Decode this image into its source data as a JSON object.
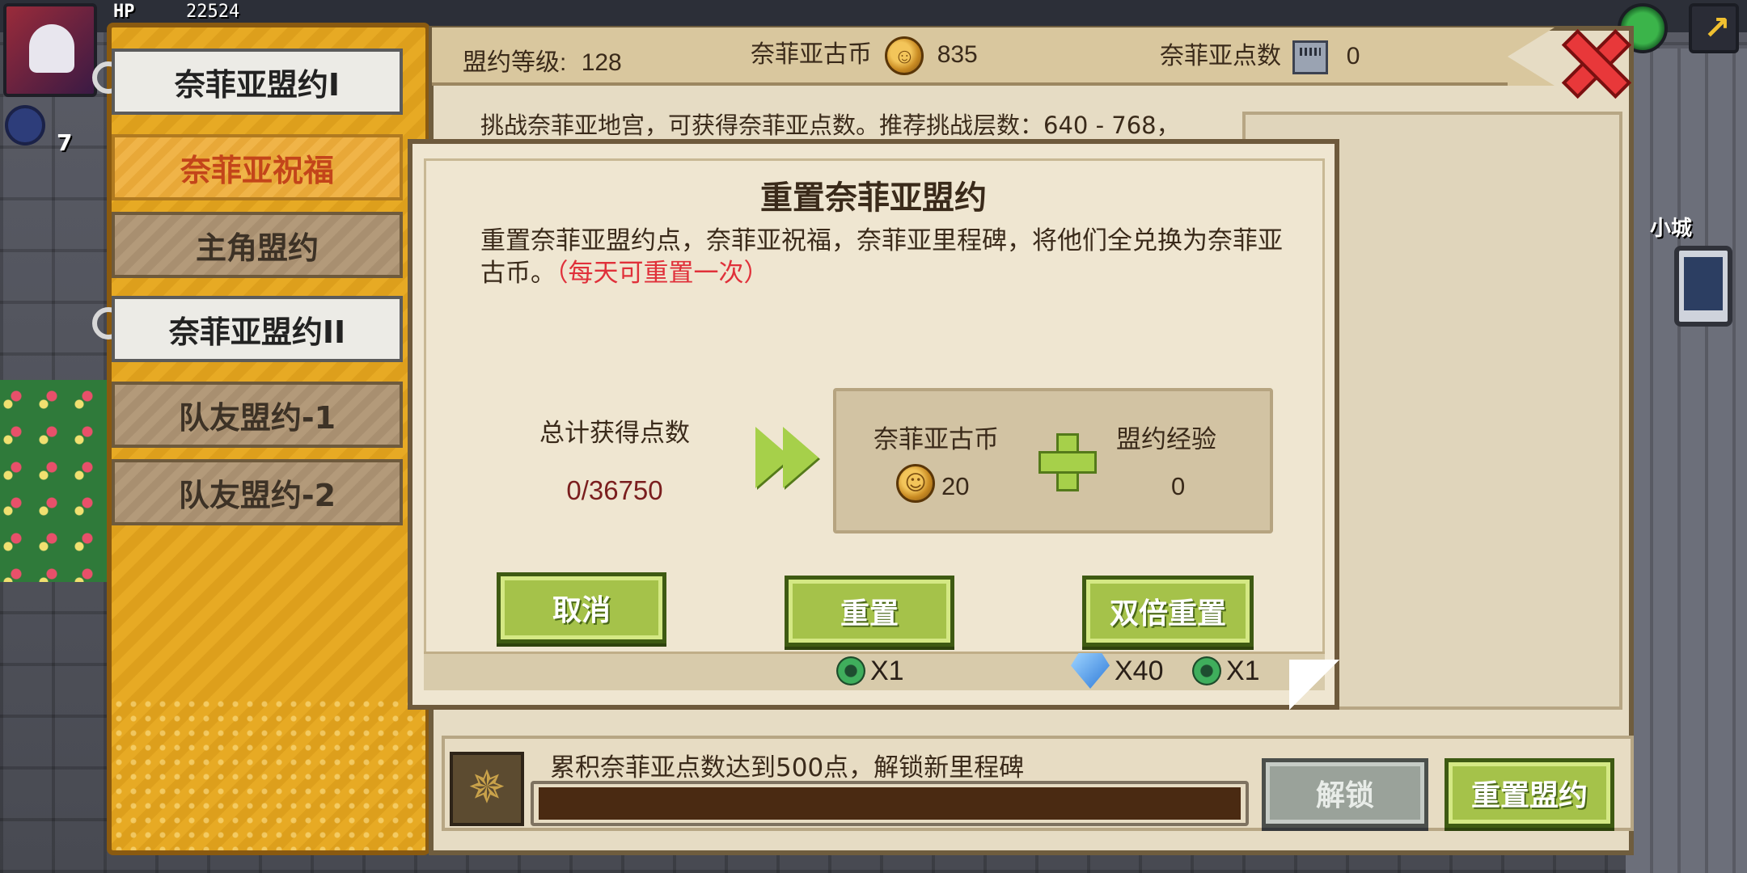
{
  "hud": {
    "hp_label": "HP",
    "hp_value": "22524",
    "badge_count": "7"
  },
  "world": {
    "city_label": "小城"
  },
  "header": {
    "level_label": "盟约等级:",
    "level_value": "128",
    "coin_label": "奈菲亚古币",
    "coin_value": "835",
    "points_label": "奈菲亚点数",
    "points_value": "0"
  },
  "challenge_text": "挑战奈菲亚地宫，可获得奈菲亚点数。推荐挑战层数：640 - 768，",
  "tabs": [
    {
      "label": "奈菲亚盟约I",
      "state": "selected"
    },
    {
      "label": "奈菲亚祝福",
      "state": "highlight"
    },
    {
      "label": "主角盟约",
      "state": "normal"
    },
    {
      "label": "奈菲亚盟约II",
      "state": "selected"
    },
    {
      "label": "队友盟约-1",
      "state": "normal"
    },
    {
      "label": "队友盟约-2",
      "state": "normal"
    }
  ],
  "modal": {
    "title": "重置奈菲亚盟约",
    "description": "重置奈菲亚盟约点，奈菲亚祝福，奈菲亚里程碑，将他们全兑换为奈菲亚古币。",
    "warning": "（每天可重置一次）",
    "total_label": "总计获得点数",
    "total_value": "0/36750",
    "reward": {
      "coin_label": "奈菲亚古币",
      "coin_value": "20",
      "exp_label": "盟约经验",
      "exp_value": "0"
    },
    "buttons": {
      "cancel": "取消",
      "reset": "重置",
      "double_reset": "双倍重置"
    },
    "costs": {
      "reset_cost": "X1",
      "double_gem_cost": "X40",
      "double_ring_cost": "X1"
    }
  },
  "bottom": {
    "milestone_text": "累积奈菲亚点数达到500点，解锁新里程碑",
    "progress": 0,
    "unlock_label": "解锁",
    "reset_label": "重置盟约"
  },
  "colors": {
    "tab_column": "#e7aa24",
    "button_green": "#a5c24a",
    "warning_red": "#e0303a",
    "close_red": "#e8383a"
  }
}
